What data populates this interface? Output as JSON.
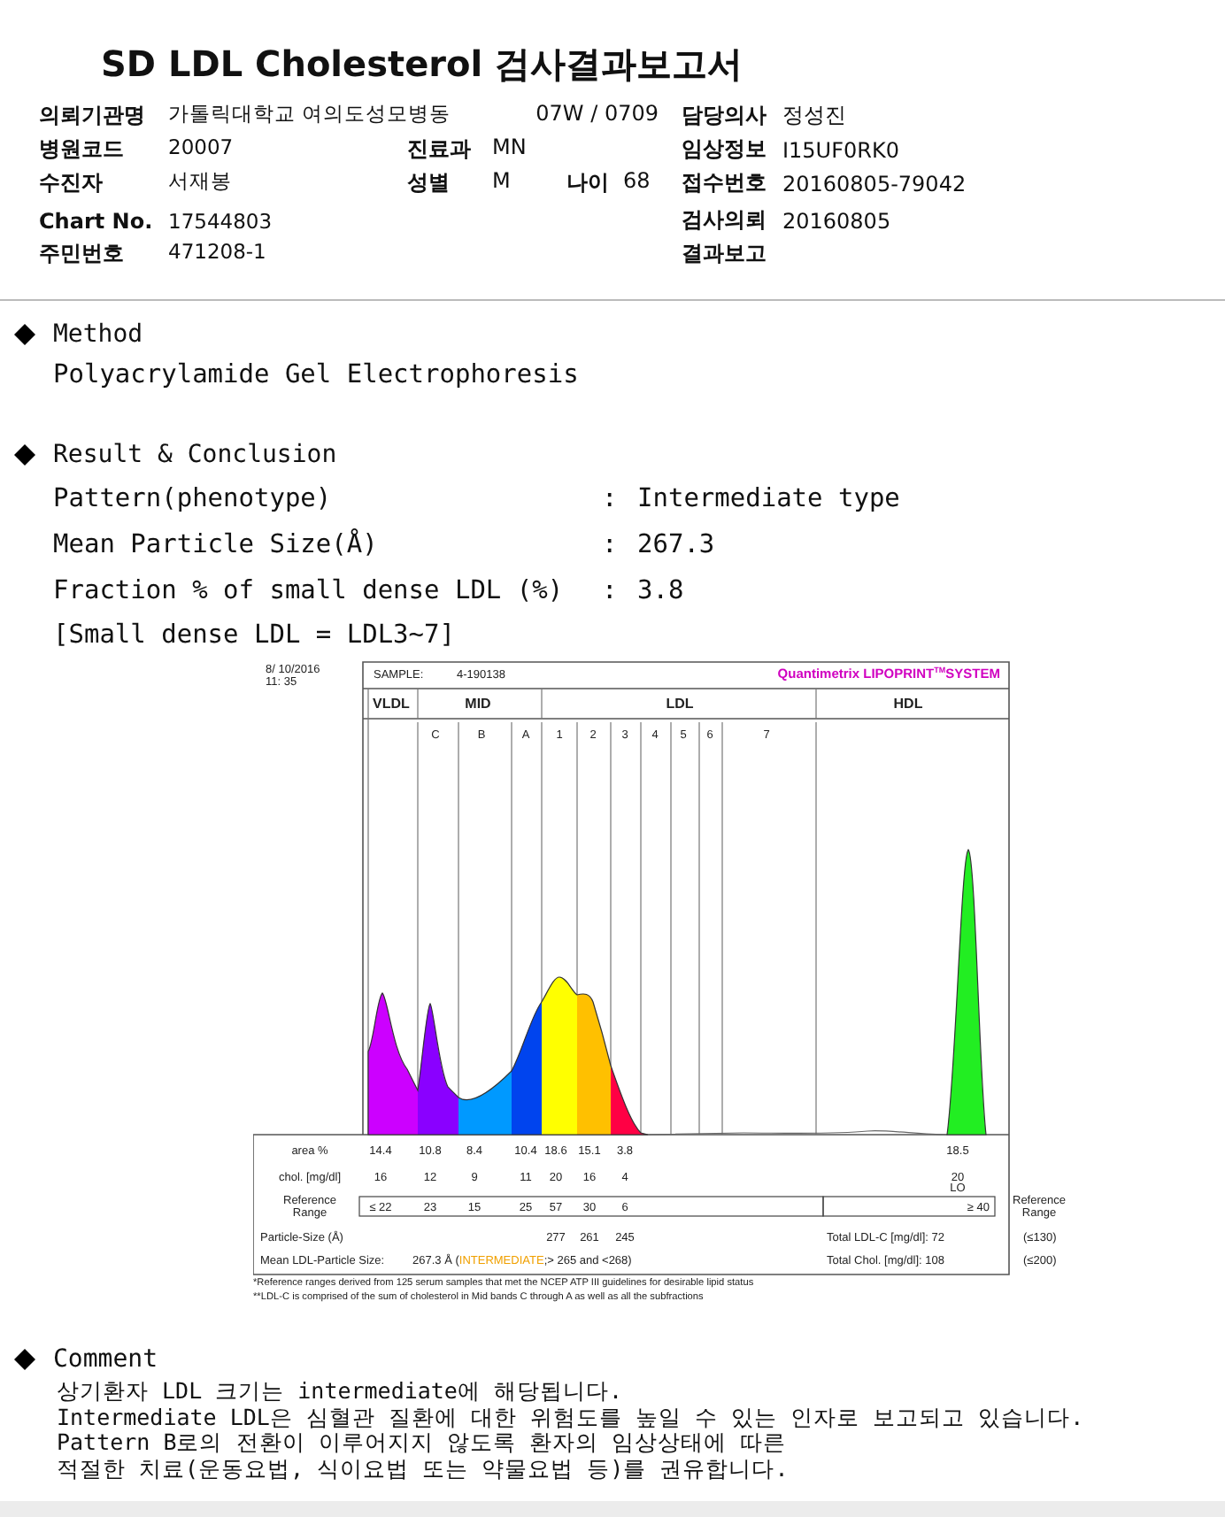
{
  "title": "SD LDL Cholesterol 검사결과보고서",
  "header_rows": [
    {
      "left": {
        "label": "의뢰기관명",
        "value": "가톨릭대학교 여의도성모병동"
      },
      "middle": [
        {
          "value": "07W / 0709"
        }
      ],
      "right": {
        "label": "담당의사",
        "value": "정성진"
      }
    },
    {
      "left": {
        "label": "병원코드",
        "value": "20007"
      },
      "middle": [
        {
          "label": "진료과",
          "value": "MN"
        }
      ],
      "right": {
        "label": "임상정보",
        "value": "I15UF0RK0"
      }
    },
    {
      "left": {
        "label": "수진자",
        "value": "서재봉"
      },
      "middle": [
        {
          "label": "성별",
          "value": "M"
        },
        {
          "label": "나이",
          "value": "68"
        }
      ],
      "right": {
        "label": "접수번호",
        "value": "20160805-79042"
      }
    },
    {
      "left": {
        "label": "Chart No.",
        "value": "17544803"
      },
      "right": {
        "label": "검사의뢰",
        "value": "20160805"
      }
    },
    {
      "left": {
        "label": "주민번호",
        "value": "471208-1"
      },
      "right": {
        "label": "결과보고"
      }
    }
  ],
  "method": {
    "heading": "Method",
    "text": "Polyacrylamide Gel Electrophoresis"
  },
  "result": {
    "heading": "Result & Conclusion",
    "rows": [
      {
        "label": "Pattern(phenotype)",
        "separator": ":",
        "value": "Intermediate type"
      },
      {
        "label": "Mean Particle Size(Å)",
        "separator": ":",
        "value": "267.3"
      },
      {
        "label": "Fraction % of small dense LDL (%)",
        "separator": ":",
        "value": "3.8"
      }
    ],
    "note": "[Small dense LDL = LDL3~7]",
    "chart": {
      "timestamp_lines": [
        "8/ 10/2016",
        "11: 35"
      ],
      "sample_label": "SAMPLE:",
      "sample_id": "4-190138",
      "brand": "Quantimetrix LIPOPRINT",
      "brand_mark": "TM",
      "brand_suffix": "SYSTEM",
      "group_labels": [
        "VLDL",
        "MID",
        "LDL",
        "HDL"
      ],
      "band_labels": [
        "C",
        "B",
        "A",
        "1",
        "2",
        "3",
        "4",
        "5",
        "6",
        "7"
      ],
      "rows": [
        {
          "label": "area %",
          "values": [
            "14.4",
            "10.8",
            "8.4",
            "10.4",
            "18.6",
            "15.1",
            "3.8"
          ],
          "hdl": "18.5"
        },
        {
          "label": "chol. [mg/dl]",
          "values": [
            "16",
            "12",
            "9",
            "11",
            "20",
            "16",
            "4"
          ],
          "hdl": "20",
          "flag": "LO"
        }
      ],
      "reference": {
        "label_lines": [
          "Reference",
          "Range"
        ],
        "values": [
          "≤ 22",
          "23",
          "15",
          "25",
          "57",
          "30",
          "6"
        ],
        "hdl": "≥ 40",
        "side_label_lines": [
          "Reference",
          "Range"
        ]
      },
      "particle_size": {
        "label": "Particle-Size (Å)",
        "values": [
          "277",
          "261",
          "245"
        ]
      },
      "mean_size": {
        "label": "Mean LDL-Particle Size:",
        "value": "267.3 Å (",
        "category": "INTERMEDIATE",
        "range": ";> 265 and <268)"
      },
      "totals": [
        {
          "label": "Total LDL-C [mg/dl]: 72",
          "limit": "(≤130)"
        },
        {
          "label": "Total Chol. [mg/dl]:  108",
          "limit": "(≤200)"
        }
      ],
      "notes": [
        "*Reference ranges derived from 125 serum samples that met the NCEP ATP III guidelines for desirable lipid status",
        "**LDL-C is comprised of the sum of cholesterol in Mid bands C through A as well as all the subfractions"
      ]
    }
  },
  "comment": {
    "heading": "Comment",
    "lines": [
      "상기환자 LDL 크기는 intermediate에 해당됩니다.",
      "Intermediate LDL은 심혈관 질환에 대한 위험도를 높일 수 있는 인자로 보고되고 있습니다.",
      "Pattern B로의 전환이 이루어지지 않도록 환자의 임상상태에 따른",
      "적절한 치료(운동요법, 식이요법 또는 약물요법 등)를 권유합니다."
    ]
  }
}
